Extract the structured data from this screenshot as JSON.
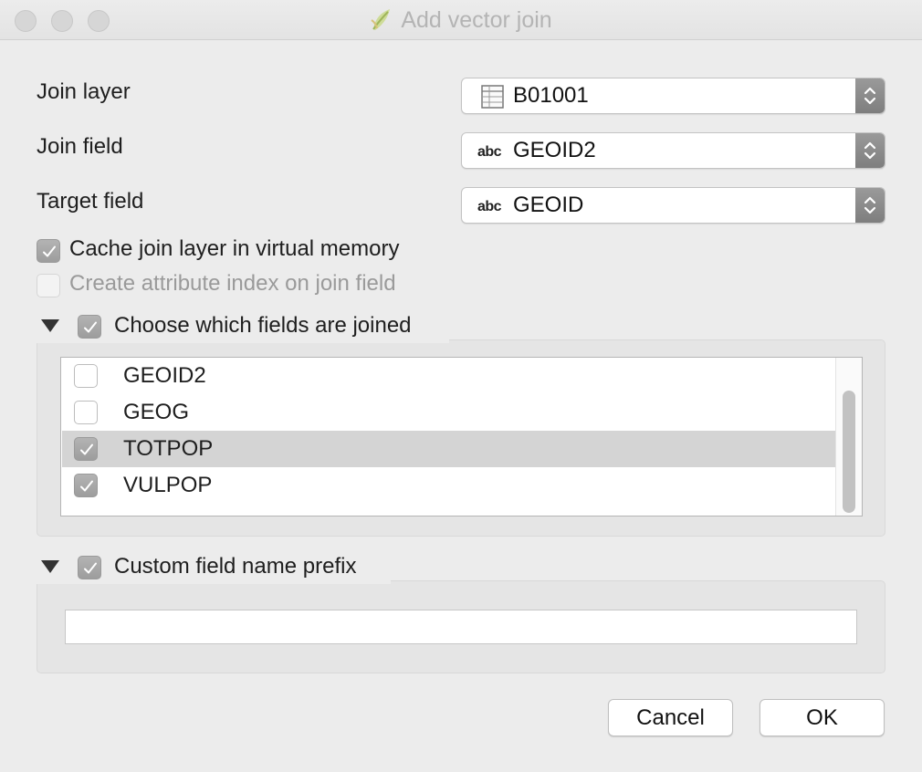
{
  "window": {
    "title": "Add vector join"
  },
  "form": {
    "join_layer": {
      "label": "Join layer",
      "value": "B01001",
      "icon": "table-icon"
    },
    "join_field": {
      "label": "Join field",
      "value": "GEOID2",
      "type_badge": "abc"
    },
    "target_field": {
      "label": "Target field",
      "value": "GEOID",
      "type_badge": "abc"
    }
  },
  "options": {
    "cache": {
      "label": "Cache join layer in virtual memory",
      "checked": true
    },
    "index": {
      "label": "Create attribute index on join field",
      "checked": false,
      "disabled": true
    }
  },
  "fields_group": {
    "label": "Choose which fields are joined",
    "checked": true,
    "items": [
      {
        "label": "GEOID2",
        "checked": false
      },
      {
        "label": "GEOG",
        "checked": false
      },
      {
        "label": "TOTPOP",
        "checked": true,
        "selected": true
      },
      {
        "label": "VULPOP",
        "checked": true
      }
    ]
  },
  "prefix_group": {
    "label": "Custom field name prefix",
    "checked": true,
    "value": ""
  },
  "buttons": {
    "cancel": "Cancel",
    "ok": "OK"
  },
  "colors": {
    "checkbox_checked": "#a8a8a8",
    "selection": "#d4d4d4",
    "window_bg": "#ececec"
  }
}
